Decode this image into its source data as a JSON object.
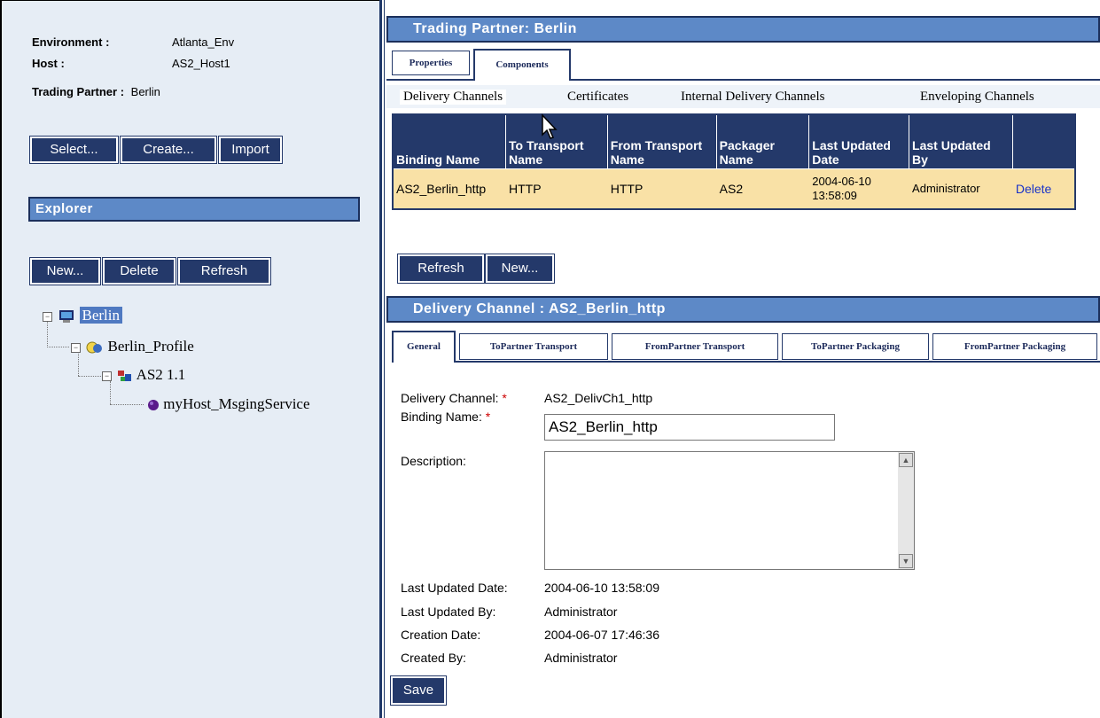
{
  "left": {
    "environment_label": "Environment :",
    "environment_value": "Atlanta_Env",
    "host_label": "Host :",
    "host_value": "AS2_Host1",
    "partner_label": "Trading Partner :",
    "partner_value": "Berlin",
    "buttons": {
      "select": "Select...",
      "create": "Create...",
      "import": "Import"
    },
    "explorer_title": "Explorer",
    "explorer_buttons": {
      "new": "New...",
      "delete": "Delete",
      "refresh": "Refresh"
    },
    "tree": [
      {
        "label": "Berlin",
        "icon": "computer-icon",
        "selected": true
      },
      {
        "label": "Berlin_Profile",
        "icon": "profile-icon"
      },
      {
        "label": "AS2 1.1",
        "icon": "protocol-icon"
      },
      {
        "label": "myHost_MsgingService",
        "icon": "service-dot-icon"
      }
    ]
  },
  "right": {
    "header_title": "Trading Partner:  Berlin",
    "top_tabs": [
      "Properties",
      "Components"
    ],
    "active_top_tab": "Components",
    "sub_tabs": [
      "Delivery Channels",
      "Certificates",
      "Internal Delivery Channels",
      "Enveloping Channels"
    ],
    "active_sub_tab": "Delivery Channels",
    "table": {
      "columns": [
        "Binding Name",
        "To Transport Name",
        "From Transport Name",
        "Packager Name",
        "Last Updated Date",
        "Last Updated By",
        ""
      ],
      "rows": [
        {
          "binding_name": "AS2_Berlin_http",
          "to_transport": "HTTP",
          "from_transport": "HTTP",
          "packager": "AS2",
          "last_updated_date": "2004-06-10 13:58:09",
          "last_updated_by": "Administrator",
          "action": "Delete"
        }
      ]
    },
    "table_buttons": {
      "refresh": "Refresh",
      "new": "New..."
    },
    "channel_title": "Delivery Channel :  AS2_Berlin_http",
    "channel_tabs": [
      "General",
      "ToPartner Transport",
      "FromPartner Transport",
      "ToPartner Packaging",
      "FromPartner Packaging"
    ],
    "active_channel_tab": "General",
    "form": {
      "delivery_channel_label": "Delivery Channel:",
      "delivery_channel_value": "AS2_DelivCh1_http",
      "binding_name_label": "Binding Name:",
      "binding_name_value": "AS2_Berlin_http",
      "description_label": "Description:",
      "description_value": "",
      "last_updated_date_label": "Last Updated Date:",
      "last_updated_date_value": "2004-06-10 13:58:09",
      "last_updated_by_label": "Last Updated By:",
      "last_updated_by_value": "Administrator",
      "creation_date_label": "Creation Date:",
      "creation_date_value": "2004-06-07 17:46:36",
      "created_by_label": "Created By:",
      "created_by_value": "Administrator",
      "required_marker": "*"
    },
    "save_button": "Save"
  },
  "colors": {
    "navy": "#24396a",
    "header_blue": "#5d89c7",
    "left_bg": "#e6edf5",
    "row_highlight": "#f9e1a6",
    "link_blue": "#1a33c8"
  }
}
